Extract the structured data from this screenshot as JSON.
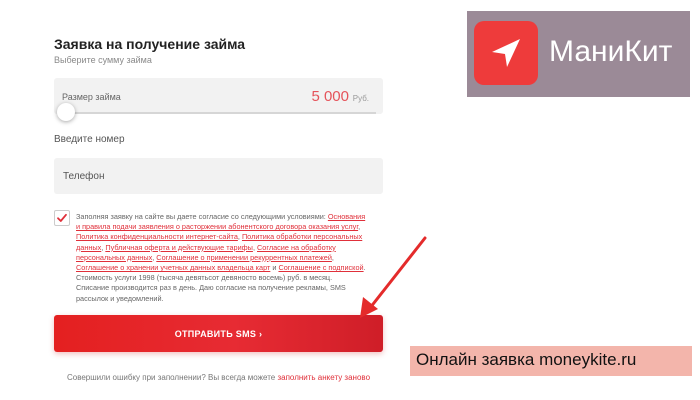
{
  "form": {
    "title": "Заявка на получение займа",
    "subtitle": "Выберите сумму займа",
    "amount": {
      "label": "Размер займа",
      "value": "5 000",
      "currency": "Руб.",
      "slider_fraction": 0
    },
    "phone": {
      "caption": "Введите номер",
      "placeholder": "Телефон",
      "value": ""
    },
    "consent": {
      "checked": true,
      "intro": "Заполняя заявку на сайте вы даете согласие со следующими условиями:",
      "link1": "Основания и правила подачи заявления о расторжении абонентского договора оказания услуг",
      "link2": "Политика конфиденциальности интернет-сайта",
      "link3": "Политика обработки персональных данных",
      "link4": "Публичная оферта и действующие тарифы",
      "link5": "Согласие на обработку персональных данных",
      "link6": "Соглашение о применении рекуррентных платежей",
      "link7": "Соглашение о хранении учетных данных владельца карт",
      "link8": "Соглашение с подпиской",
      "tail": ". Стоимость услуги 1998 (тысяча девятьсот девяносто восемь) руб. в месяц. Списание производится раз в день. Даю согласие на получение рекламы, SMS рассылок и уведомлений."
    },
    "submit_label": "ОТПРАВИТЬ SMS ›",
    "footer": {
      "text": "Совершили ошибку при заполнении? Вы всегда можете",
      "link": "заполнить анкету заново"
    }
  },
  "brand": {
    "name": "МаниКит",
    "icon": "navigation-arrow-icon",
    "color": "#ee3b3b",
    "panel_color": "#9b8a97"
  },
  "caption": {
    "text": "Онлайн заявка moneykite.ru",
    "bg_color": "#f3b5ab"
  },
  "accent_color": "#e42020"
}
